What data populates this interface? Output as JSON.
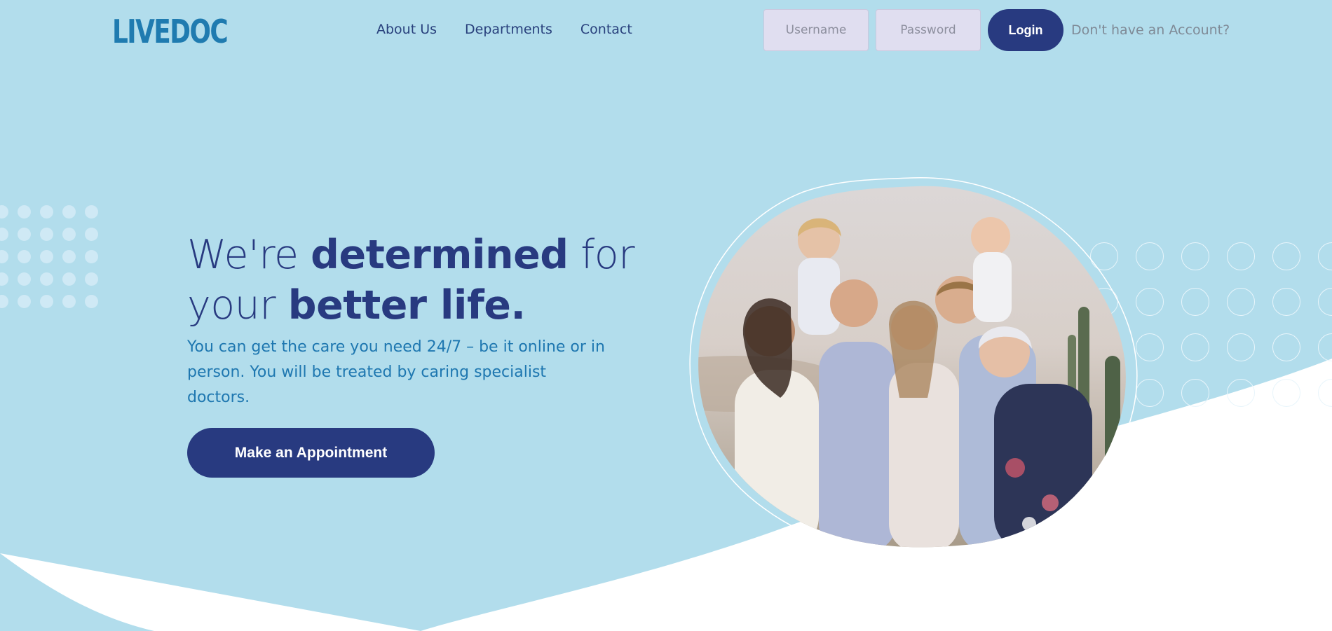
{
  "brand": {
    "logo_text": "LIVEDOC"
  },
  "nav": {
    "items": [
      "About Us",
      "Departments",
      "Contact"
    ]
  },
  "auth": {
    "username_placeholder": "Username",
    "password_placeholder": "Password",
    "login_label": "Login",
    "signup_text": "Don't have an Account?"
  },
  "hero": {
    "title": {
      "part1": "We're",
      "bold1": "determined",
      "part2": "for",
      "part3": "your",
      "bold2": "better life."
    },
    "subtitle": "You can get the care you need 24/7 – be it online or in person. You will be treated by caring specialist doctors.",
    "cta_label": "Make an Appointment"
  },
  "image": {
    "subject": "family-photo"
  },
  "colors": {
    "background": "#b2ddec",
    "primary": "#283a80",
    "accent": "#1f7bb0",
    "white": "#ffffff"
  }
}
